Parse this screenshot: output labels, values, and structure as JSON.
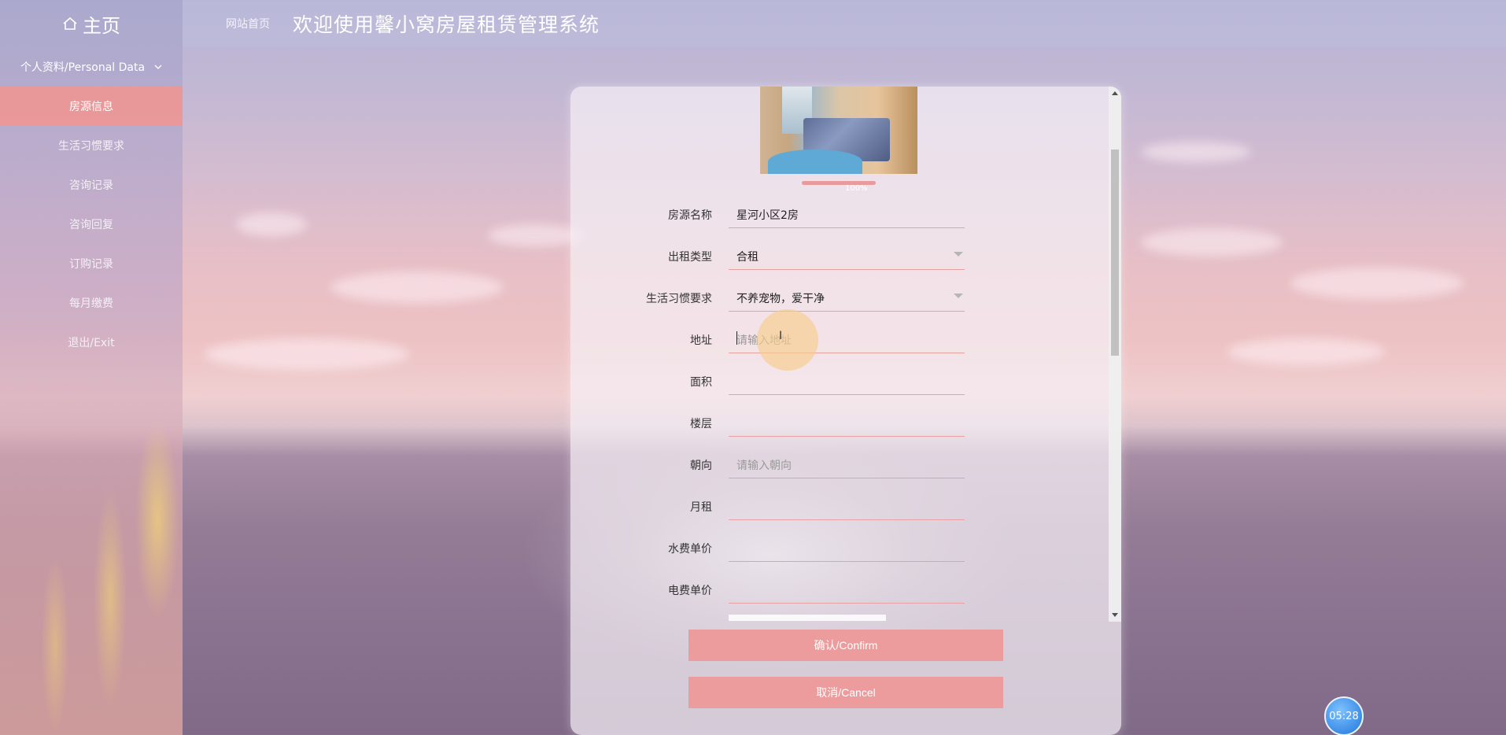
{
  "sidebar": {
    "home_label": "主页",
    "group_label": "个人资料/Personal Data",
    "items": [
      {
        "label": "房源信息",
        "active": true
      },
      {
        "label": "生活习惯要求"
      },
      {
        "label": "咨询记录"
      },
      {
        "label": "咨询回复"
      },
      {
        "label": "订购记录"
      },
      {
        "label": "每月缴费"
      },
      {
        "label": "退出/Exit"
      }
    ]
  },
  "header": {
    "breadcrumb": "网站首页",
    "title": "欢迎使用馨小窝房屋租赁管理系统"
  },
  "form": {
    "upload_progress": "100%",
    "fields": [
      {
        "label": "房源名称",
        "value": "星河小区2房",
        "placeholder": ""
      },
      {
        "label": "出租类型",
        "value": "合租",
        "type": "select"
      },
      {
        "label": "生活习惯要求",
        "value": "不养宠物，爱干净",
        "type": "select"
      },
      {
        "label": "地址",
        "value": "",
        "placeholder": "请输入地址"
      },
      {
        "label": "面积",
        "value": "",
        "placeholder": ""
      },
      {
        "label": "楼层",
        "value": "",
        "placeholder": ""
      },
      {
        "label": "朝向",
        "value": "",
        "placeholder": "请输入朝向"
      },
      {
        "label": "月租",
        "value": "",
        "placeholder": ""
      },
      {
        "label": "水费单价",
        "value": "",
        "placeholder": ""
      },
      {
        "label": "电费单价",
        "value": "",
        "placeholder": ""
      }
    ],
    "confirm_label": "确认/Confirm",
    "cancel_label": "取消/Cancel"
  },
  "timer": "05:28",
  "colors": {
    "accent": "#ec9c9c",
    "active_menu": "#ee9696",
    "field_underline": "#e6a2a2"
  }
}
